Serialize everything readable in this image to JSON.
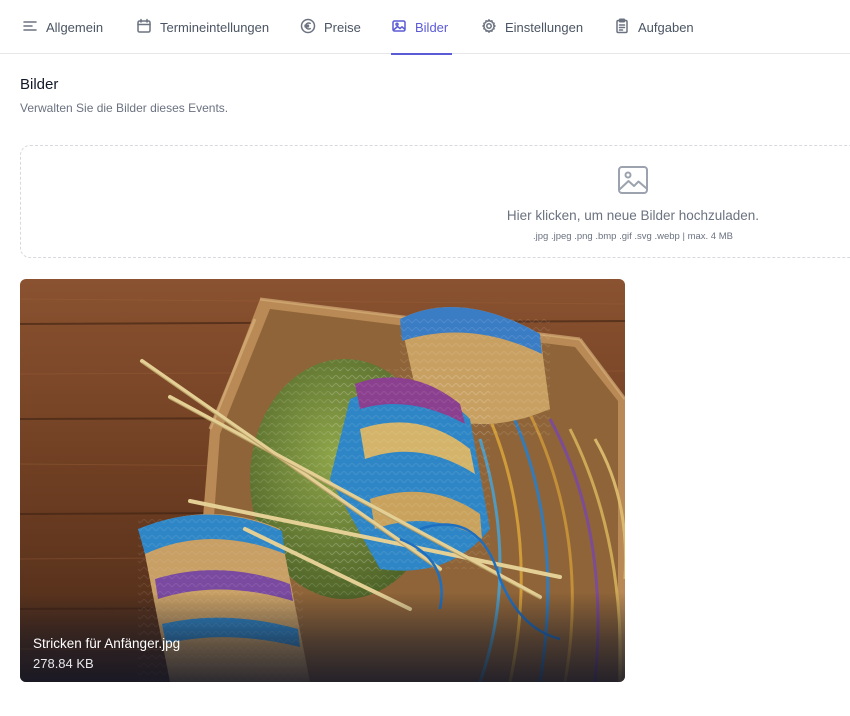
{
  "tabs": [
    {
      "label": "Allgemein",
      "icon": "menu-lines-icon"
    },
    {
      "label": "Termineintellungen",
      "icon": "calendar-icon"
    },
    {
      "label": "Preise",
      "icon": "euro-circle-icon"
    },
    {
      "label": "Bilder",
      "icon": "image-icon",
      "active": true
    },
    {
      "label": "Einstellungen",
      "icon": "gear-icon"
    },
    {
      "label": "Aufgaben",
      "icon": "clipboard-icon"
    }
  ],
  "section": {
    "title": "Bilder",
    "subtitle": "Verwalten Sie die Bilder dieses Events."
  },
  "dropzone": {
    "text": "Hier klicken, um neue Bilder hochzuladen.",
    "formats": ".jpg .jpeg .png .bmp .gif .svg .webp | max. 4 MB",
    "icon": "image-upload-icon"
  },
  "images": [
    {
      "filename": "Stricken für Anfänger.jpg",
      "size": "278.84 KB"
    }
  ],
  "colors": {
    "accent": "#5b5bd6",
    "muted_text": "#6b7280"
  }
}
